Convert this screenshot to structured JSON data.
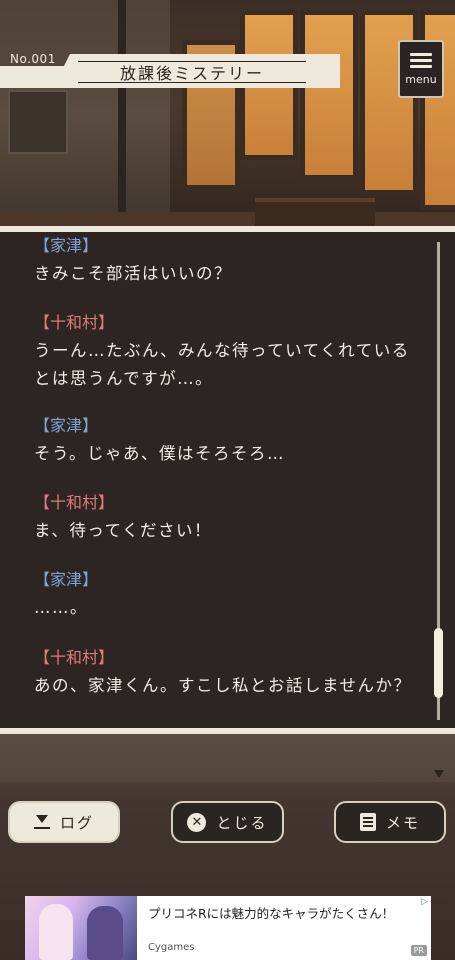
{
  "header": {
    "episode_no": "No.001",
    "title": "放課後ミステリー",
    "menu_label": "menu"
  },
  "log": {
    "entries": [
      {
        "speaker": "【家津】",
        "lines": [
          "きみこそ部活はいいの？"
        ]
      },
      {
        "speaker": "【十和村】",
        "lines": [
          "うーん…たぶん、みんな待っていてくれている",
          "とは思うんですが…。"
        ]
      },
      {
        "speaker": "【家津】",
        "lines": [
          "そう。じゃあ、僕はそろそろ…"
        ]
      },
      {
        "speaker": "【十和村】",
        "lines": [
          "ま、待ってください！"
        ]
      },
      {
        "speaker": "【家津】",
        "lines": [
          "……。"
        ]
      },
      {
        "speaker": "【十和村】",
        "lines": [
          "あの、家津くん。すこし私とお話しませんか？"
        ]
      }
    ]
  },
  "controls": {
    "log_label": "ログ",
    "close_label": "とじる",
    "close_icon_glyph": "✕",
    "memo_label": "メモ"
  },
  "ad": {
    "text": "プリコネRには魅力的なキャラがたくさん！",
    "brand": "Cygames",
    "pr": "PR",
    "info_glyph": "▷"
  },
  "colors": {
    "speaker_ietsu": "#7fa3d4",
    "speaker_towamura": "#e07a78",
    "panel_bg": "#2c2522",
    "cream": "#efe9dd"
  }
}
